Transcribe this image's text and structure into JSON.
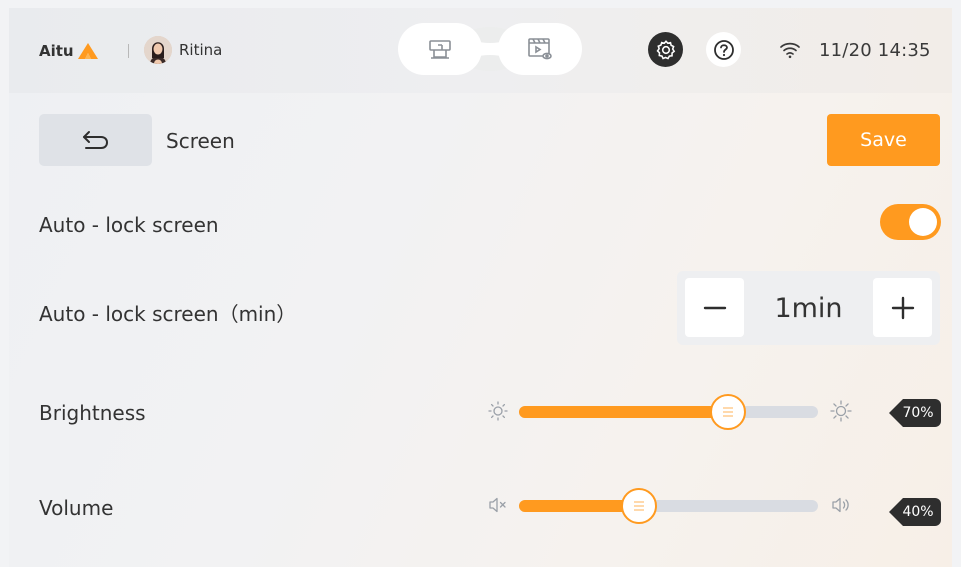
{
  "header": {
    "logo_text": "Aitu",
    "user_name": "Ritina",
    "datetime": "11/20 14:35",
    "icons": {
      "logo": "aitu-logo-mark",
      "mode_1": "machine-icon",
      "mode_2": "video-preview-icon",
      "settings": "gear-icon",
      "help": "help-icon",
      "wifi": "wifi-icon"
    }
  },
  "page": {
    "title": "Screen",
    "back_icon": "back-arrow-icon",
    "save_label": "Save"
  },
  "settings": {
    "auto_lock": {
      "label": "Auto - lock screen",
      "enabled": true
    },
    "auto_lock_min": {
      "label": "Auto - lock screen（min）",
      "value": "1min"
    },
    "brightness": {
      "label": "Brightness",
      "value": 70,
      "badge": "70%"
    },
    "volume": {
      "label": "Volume",
      "value": 40,
      "badge": "40%"
    }
  },
  "colors": {
    "accent": "#ff9a1f",
    "dark": "#2e2e2e",
    "track": "#d9dce2"
  }
}
